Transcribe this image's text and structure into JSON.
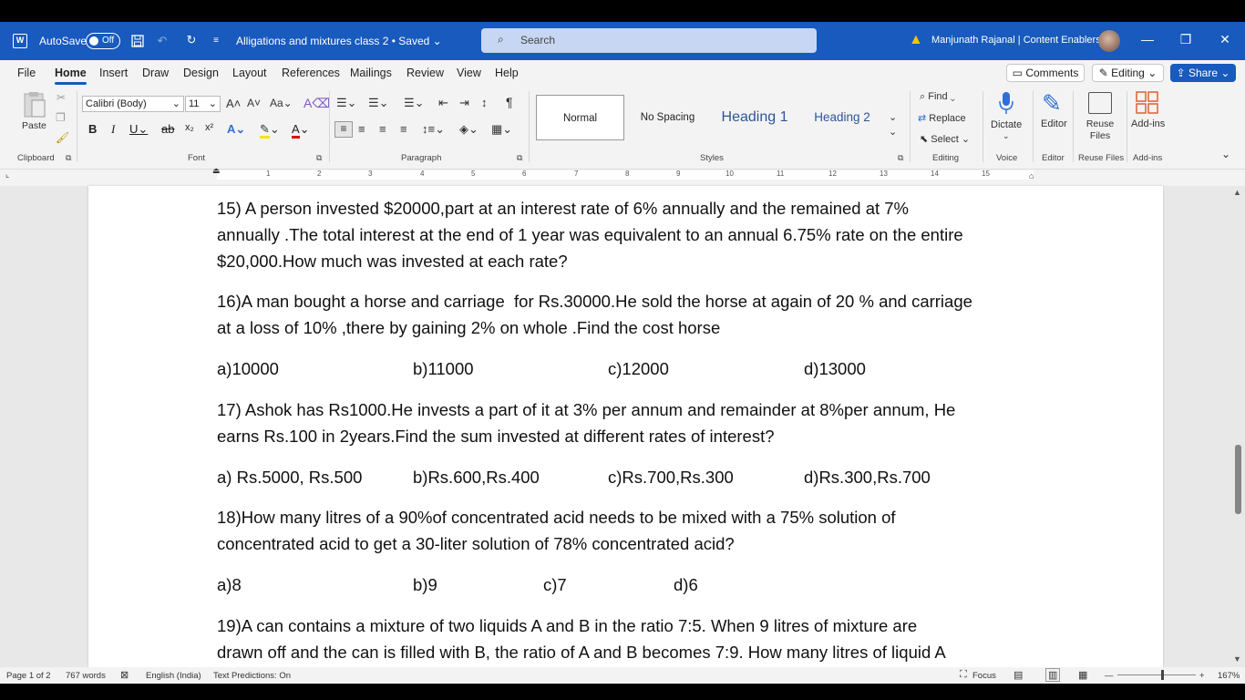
{
  "titlebar": {
    "autosave_label": "AutoSave",
    "autosave_state": "Off",
    "doc_title": "Alligations and mixtures class 2 • Saved ⌄",
    "search_placeholder": "Search",
    "user_name": "Manjunath Rajanal | Content Enablers"
  },
  "menu": {
    "tabs": [
      "File",
      "Home",
      "Insert",
      "Draw",
      "Design",
      "Layout",
      "References",
      "Mailings",
      "Review",
      "View",
      "Help"
    ],
    "comments": "Comments",
    "editing": "Editing",
    "share": "Share"
  },
  "ribbon": {
    "paste": "Paste",
    "font_name": "Calibri (Body)",
    "font_size": "11",
    "styles": [
      "Normal",
      "No Spacing",
      "Heading 1",
      "Heading 2"
    ],
    "find": "Find",
    "replace": "Replace",
    "select": "Select",
    "dictate": "Dictate",
    "editor": "Editor",
    "reuse_files": "Reuse Files",
    "addins": "Add-ins",
    "groups": {
      "clipboard": "Clipboard",
      "font": "Font",
      "paragraph": "Paragraph",
      "styles": "Styles",
      "editing": "Editing",
      "voice": "Voice",
      "editor": "Editor",
      "reuse_files": "Reuse Files",
      "addins": "Add-ins"
    }
  },
  "ruler": [
    "1",
    "2",
    "3",
    "4",
    "5",
    "6",
    "7",
    "8",
    "9",
    "10",
    "11",
    "12",
    "13",
    "14",
    "15"
  ],
  "document": {
    "q15": "15) A person invested $20000,part at an interest rate of 6% annually and the remained at 7%\nannually .The total interest at the end of 1 year was equivalent to an annual 6.75% rate on the entire\n$20,000.How much was invested at each rate?",
    "q16": "16)A man bought a horse and carriage  for Rs.30000.He sold the horse at again of 20 % and carriage\nat a loss of 10% ,there by gaining 2% on whole .Find the cost horse",
    "q16_options": [
      "a)10000",
      "b)11000",
      "c)12000",
      "d)13000"
    ],
    "q17": "17) Ashok has Rs1000.He invests a part of it at 3% per annum and remainder at 8%per annum, He\nearns Rs.100 in 2years.Find the sum invested at different rates of interest?",
    "q17_options": [
      "a) Rs.5000, Rs.500",
      "b)Rs.600,Rs.400",
      "c)Rs.700,Rs.300",
      "d)Rs.300,Rs.700"
    ],
    "q18": "18)How many litres of a 90%of concentrated acid needs to be mixed with a 75% solution of\nconcentrated acid to get a 30-liter solution of 78% concentrated acid?",
    "q18_options": [
      "a)8",
      "b)9",
      "c)7",
      "d)6"
    ],
    "q19": "19)A can contains a mixture of two liquids A and B in the ratio 7:5. When 9 litres of mixture are\ndrawn off and the can is filled with B, the ratio of A and B becomes 7:9. How many litres of liquid A"
  },
  "status": {
    "page": "Page 1 of 2",
    "words": "767 words",
    "language": "English (India)",
    "predictions": "Text Predictions: On",
    "focus": "Focus",
    "zoom": "167%"
  }
}
